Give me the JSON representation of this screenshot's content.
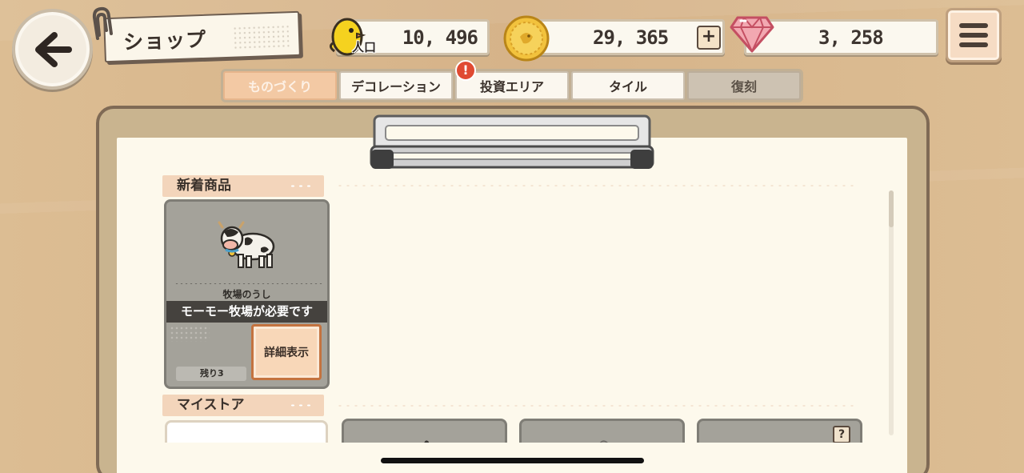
{
  "header": {
    "title": "ショップ",
    "population_label": "人口",
    "population": "10, 496",
    "coins": "29, 365",
    "gems": "3, 258",
    "plus_label": "+"
  },
  "tabs": [
    {
      "label": "ものづくり",
      "state": "active"
    },
    {
      "label": "デコレーション",
      "state": "normal"
    },
    {
      "label": "投資エリア",
      "state": "normal",
      "badge": "!"
    },
    {
      "label": "タイル",
      "state": "normal"
    },
    {
      "label": "復刻",
      "state": "disabled"
    }
  ],
  "new_items": {
    "heading": "新着商品",
    "card": {
      "name": "牧場のうし",
      "requirement": "モーモー牧場が必要です",
      "detail_button": "詳細表示",
      "remaining": "残り3"
    }
  },
  "my_store": {
    "heading": "マイストア",
    "unknown_label": "?"
  },
  "colors": {
    "accent": "#f3c9a4",
    "badge": "#e04a32",
    "board": "#c9b48f"
  }
}
